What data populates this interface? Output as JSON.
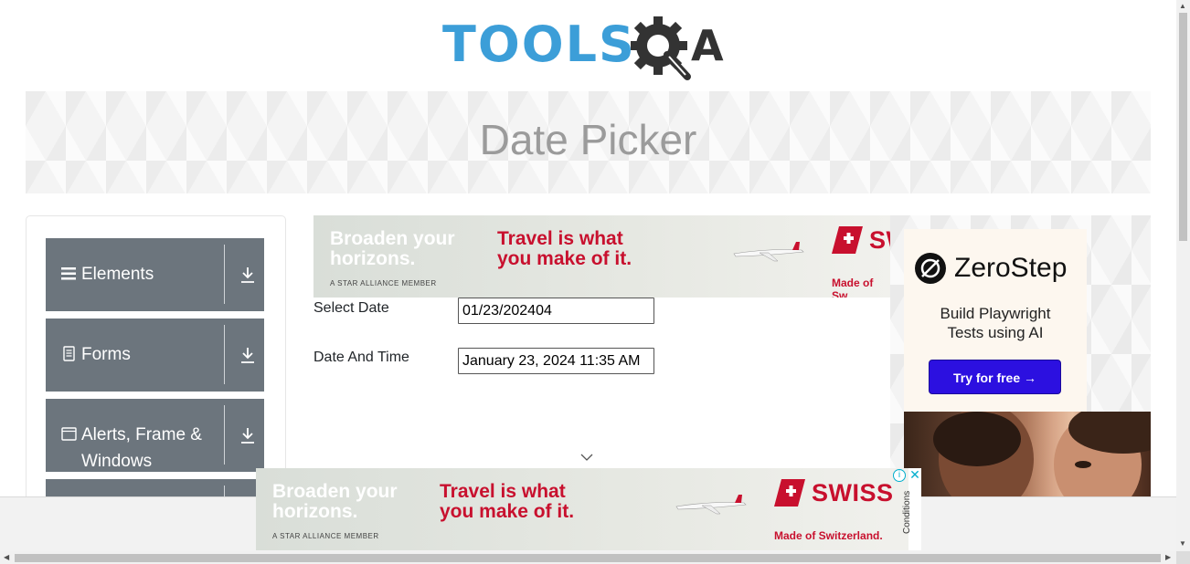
{
  "logo": {
    "text": "TOOLS",
    "suffix": "A",
    "colors": {
      "tools": "#3c9ed8",
      "qa": "#333333"
    }
  },
  "banner": {
    "title": "Date Picker"
  },
  "sidebar": {
    "groups": [
      {
        "label": "Elements",
        "icon": "hamburger-icon"
      },
      {
        "label": "Forms",
        "icon": "document-icon"
      },
      {
        "label": "Alerts, Frame & Windows",
        "icon": "window-icon"
      }
    ]
  },
  "ad_top": {
    "line1": "Broaden your",
    "line2": "horizons.",
    "member": "A STAR ALLIANCE MEMBER",
    "red1": "Travel is what",
    "red2": "you make of it.",
    "brand": "SW",
    "made": "Made of Sw"
  },
  "form": {
    "select_date": {
      "label": "Select Date",
      "value": "01/23/202404"
    },
    "date_time": {
      "label": "Date And Time",
      "value": "January 23, 2024 11:35 AM"
    }
  },
  "right_ad": {
    "brand": "ZeroStep",
    "subtitle_line1": "Build Playwright",
    "subtitle_line2": "Tests using AI",
    "button": "Try for free →"
  },
  "ad_bottom": {
    "line1": "Broaden your",
    "line2": "horizons.",
    "member": "A STAR ALLIANCE MEMBER",
    "red1": "Travel is what",
    "red2": "you make of it.",
    "brand": "SWISS",
    "made": "Made of Switzerland.",
    "conditions": "Conditions",
    "info": "i",
    "close": "✕"
  },
  "colors": {
    "accent": "#6c757d",
    "swiss_red": "#c8102e",
    "zerostep_blue": "#2c10e0"
  }
}
